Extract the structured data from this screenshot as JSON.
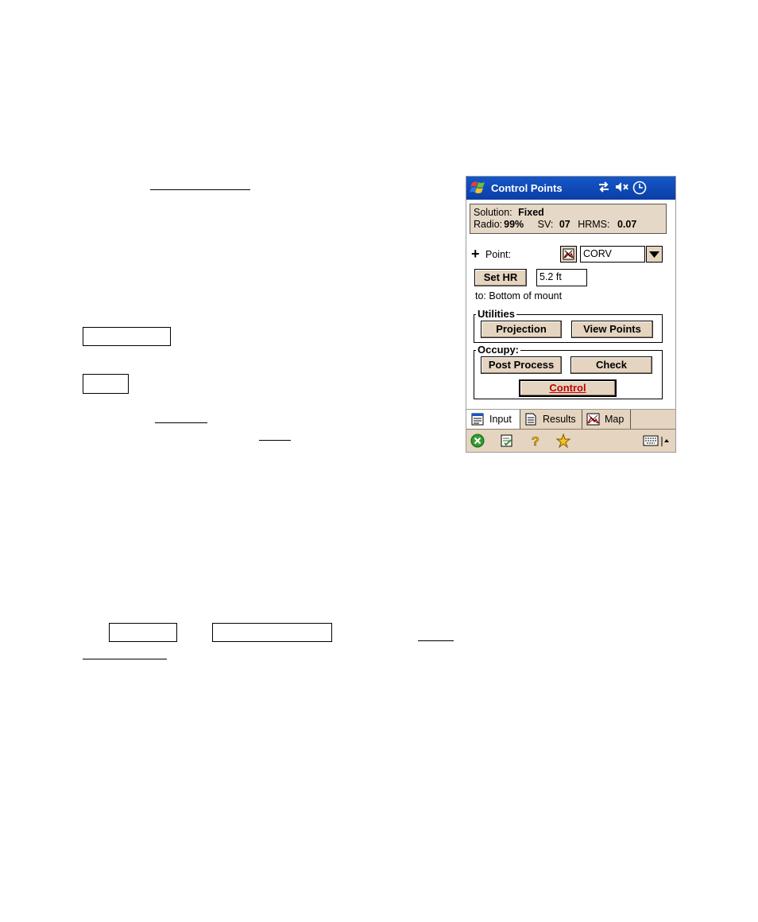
{
  "app": {
    "title": "Control Points"
  },
  "status": {
    "solution_label": "Solution:",
    "solution_value": "Fixed",
    "radio_label": "Radio:",
    "radio_value": "99%",
    "sv_label": "SV:",
    "sv_value": "07",
    "hrms_label": "HRMS:",
    "hrms_value": "0.07"
  },
  "point": {
    "label": "Point:",
    "value": "CORV"
  },
  "height": {
    "button_label": "Set HR",
    "value": "5.2 ft",
    "to_text": "to: Bottom of mount"
  },
  "utilities": {
    "label": "Utilities",
    "projection": "Projection",
    "view_points": "View Points"
  },
  "occupy": {
    "label": "Occupy:",
    "post_process": "Post Process",
    "check": "Check",
    "control": "Control"
  },
  "tabs": [
    {
      "label": "Input"
    },
    {
      "label": "Results"
    },
    {
      "label": "Map"
    }
  ],
  "colors": {
    "titlebar": "#0b3ea6",
    "panel": "#e6d8c6",
    "button": "#e4d4c0",
    "control_text": "#c00000"
  },
  "icons": [
    "windows-start-icon",
    "connectivity-icon",
    "speaker-muted-icon",
    "clock-icon",
    "map-point-icon",
    "dropdown-arrow-icon",
    "close-icon",
    "checklist-icon",
    "help-icon",
    "favorites-icon",
    "keyboard-icon"
  ]
}
